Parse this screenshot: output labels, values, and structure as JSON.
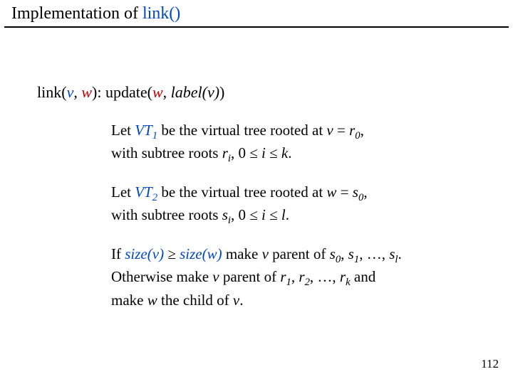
{
  "title": {
    "prefix": "Implementation of ",
    "func": "link()"
  },
  "signature": {
    "fn": "link",
    "v": "v",
    "comma": ", ",
    "w": "w",
    "close": "):  ",
    "upd": "update(",
    "upd_w": "w",
    "upd_comma": ", ",
    "label": "label(v)",
    "upd_close": ")"
  },
  "p1": {
    "let": "Let  ",
    "vt": "VT",
    "vt_sub": "1",
    "be": "  be the virtual tree rooted at  ",
    "v": "v",
    "eq": " = ",
    "r": "r",
    "r_sub": "0",
    "comma": ",",
    "line2a": "with subtree roots  ",
    "ri": "r",
    "ri_sub": "i",
    "range": ", 0 ≤ ",
    "ivar": "i",
    "le": " ≤ ",
    "k": "k",
    "dot": "."
  },
  "p2": {
    "let": "Let  ",
    "vt": "VT",
    "vt_sub": "2",
    "be": "  be the virtual tree rooted at  ",
    "w": "w",
    "eq": " = ",
    "s": "s",
    "s_sub": "0",
    "comma": ",",
    "line2a": "with subtree roots  ",
    "si": "s",
    "si_sub": "i",
    "range": ", 0 ≤ ",
    "ivar": "i",
    "le": " ≤ ",
    "l": "l",
    "dot": "."
  },
  "p3": {
    "if": "If  ",
    "size1": "size(v)",
    "ge": " ≥ ",
    "size2": "size(w)",
    "make1": "  make  ",
    "v1": "v",
    "parent1": "  parent of  ",
    "s0": "s",
    "s0_sub": "0",
    "c1": ", ",
    "s1": "s",
    "s1_sub": "1",
    "dots1": ", …, ",
    "sl": "s",
    "sl_sub": "l",
    "dotA": ".",
    "other": "Otherwise make  ",
    "v2": "v",
    "parent2": "  parent of  ",
    "r1": "r",
    "r1_sub": "1",
    "c2": ", ",
    "r2": "r",
    "r2_sub": "2",
    "dots2": ", …, ",
    "rk": "r",
    "rk_sub": "k",
    "and": "  and",
    "make2": "make  ",
    "w": "w",
    "child": "  the child of  ",
    "v3": "v",
    "dotB": "."
  },
  "pagenum": "112"
}
